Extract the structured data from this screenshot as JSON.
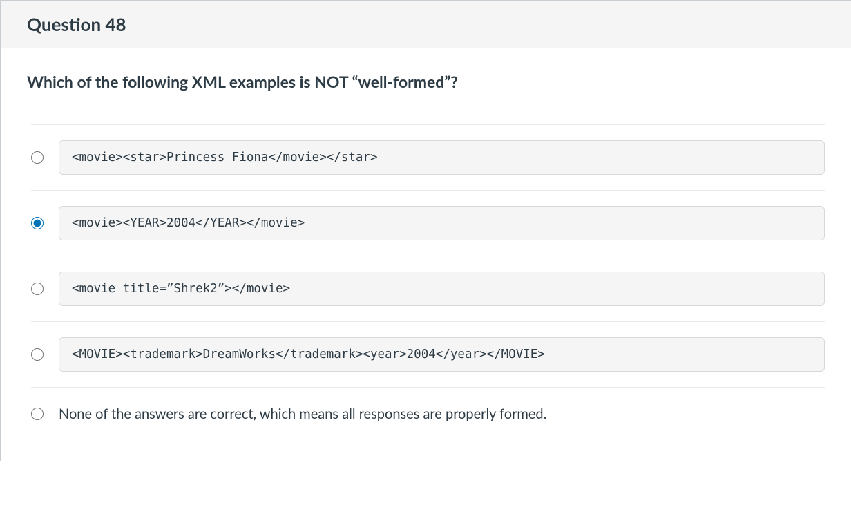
{
  "header": {
    "title": "Question 48"
  },
  "question": {
    "text": "Which of the following XML examples is NOT “well-formed”?"
  },
  "answers": [
    {
      "type": "code",
      "selected": false,
      "content": "<movie><star>Princess Fiona</movie></star>"
    },
    {
      "type": "code",
      "selected": true,
      "content": "<movie><YEAR>2004</YEAR></movie>"
    },
    {
      "type": "code",
      "selected": false,
      "content": "<movie title=”Shrek2”></movie>"
    },
    {
      "type": "code",
      "selected": false,
      "content": "<MOVIE><trademark>DreamWorks</trademark><year>2004</year></MOVIE>"
    },
    {
      "type": "plain",
      "selected": false,
      "content": "None of the answers are correct, which means all responses are properly formed."
    }
  ]
}
